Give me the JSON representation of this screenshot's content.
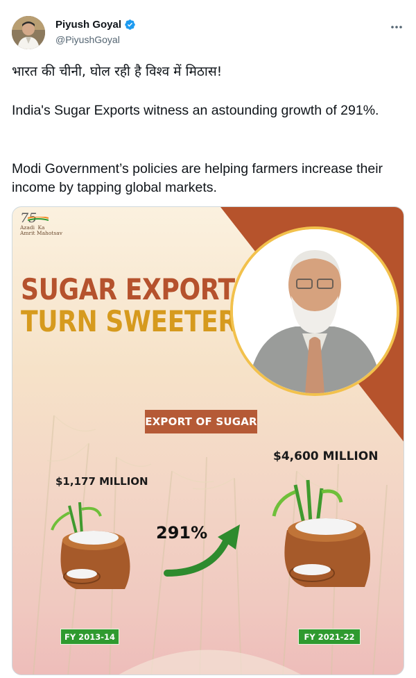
{
  "author": {
    "name": "Piyush Goyal",
    "handle": "@PiyushGoyal",
    "verified": true
  },
  "tweet": {
    "line1": "भारत की चीनी, घोल रही है विश्व में मिठास!",
    "line2": "India's Sugar Exports witness an astounding growth of 291%.",
    "line3": "Modi Government’s policies are helping farmers increase their income by tapping global markets."
  },
  "more_icon": "more-icon",
  "card": {
    "logo": {
      "number": "75",
      "line1": "Azadi",
      "line2": "Ka",
      "line3": "Amrit Mahotsav"
    },
    "headline_line1": "SUGAR EXPORTS",
    "headline_line2": "TURN SWEETER",
    "export_label": "EXPORT OF SUGAR",
    "left_value": "$1,177 MILLION",
    "right_value": "$4,600 MILLION",
    "growth": "291%",
    "left_year": "FY 2013-14",
    "right_year": "FY 2021-22",
    "colors": {
      "headline_top": "#b5522d",
      "headline_bottom": "#d69a1e",
      "label_bg": "#b55a36",
      "year_bg": "#2f9a2f",
      "arrow": "#2e8b2e",
      "corner": "#b6532c"
    }
  }
}
